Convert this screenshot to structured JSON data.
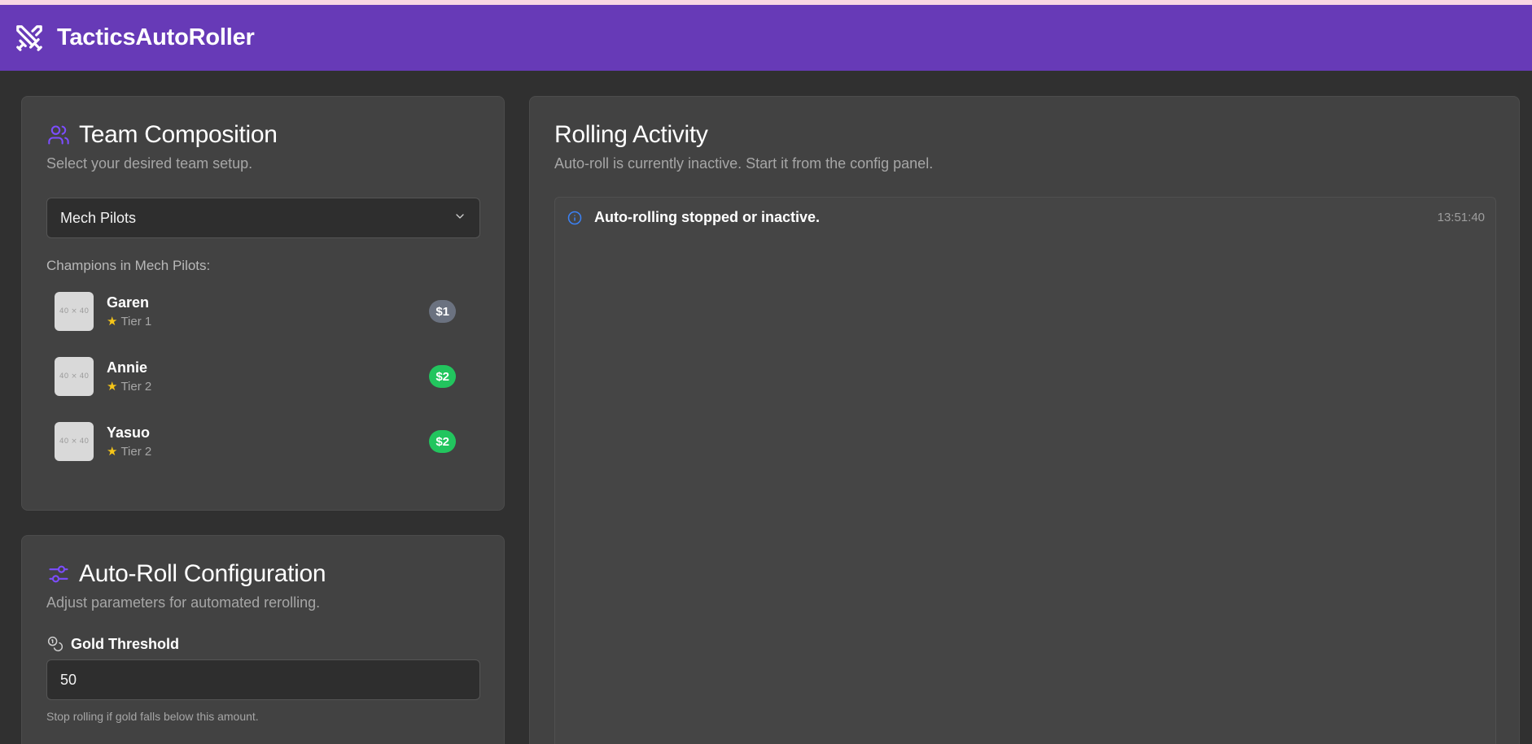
{
  "app": {
    "title": "TacticsAutoRoller",
    "logo_icon": "crossed-swords-icon",
    "brand_color": "#673ab7"
  },
  "team": {
    "title": "Team Composition",
    "icon": "users-icon",
    "subtitle": "Select your desired team setup.",
    "selected_comp": "Mech Pilots",
    "champions_title": "Champions in Mech Pilots:",
    "champions": [
      {
        "thumb": "40 × 40",
        "name": "Garen",
        "tier": "Tier 1",
        "cost": "$1",
        "badge_color": "#6b7280"
      },
      {
        "thumb": "40 × 40",
        "name": "Annie",
        "tier": "Tier 2",
        "cost": "$2",
        "badge_color": "#22c55e"
      },
      {
        "thumb": "40 × 40",
        "name": "Yasuo",
        "tier": "Tier 2",
        "cost": "$2",
        "badge_color": "#22c55e"
      }
    ]
  },
  "config": {
    "title": "Auto-Roll Configuration",
    "icon": "sliders-icon",
    "subtitle": "Adjust parameters for automated rerolling.",
    "gold_label": "Gold Threshold",
    "gold_icon": "coins-icon",
    "gold_value": "50",
    "gold_hint": "Stop rolling if gold falls below this amount."
  },
  "activity": {
    "title": "Rolling Activity",
    "subtitle": "Auto-roll is currently inactive. Start it from the config panel.",
    "entries": [
      {
        "icon": "info-icon",
        "message": "Auto-rolling stopped or inactive.",
        "time": "13:51:40"
      }
    ]
  }
}
